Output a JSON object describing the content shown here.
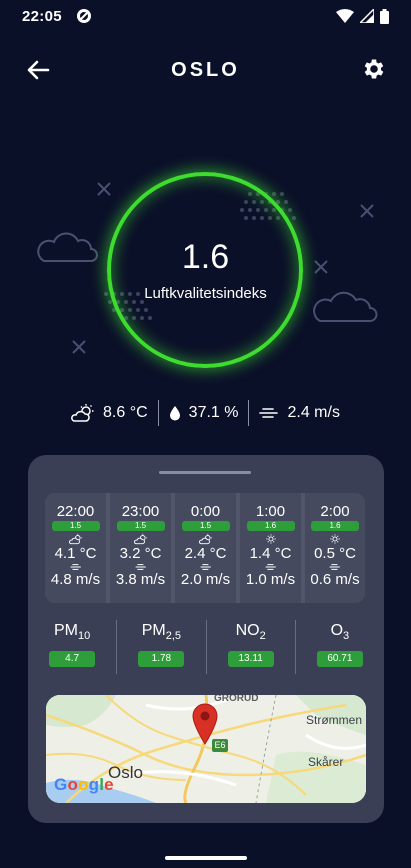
{
  "status_bar": {
    "time": "22:05"
  },
  "header": {
    "title": "OSLO"
  },
  "aqi": {
    "value": "1.6",
    "label": "Luftkvalitetsindeks"
  },
  "weather": {
    "temperature": "8.6 °C",
    "humidity": "37.1 %",
    "wind": "2.4 m/s"
  },
  "forecast": [
    {
      "time": "22:00",
      "aqi": "1.5",
      "icon": "partly-cloudy-icon",
      "temp": "4.1 °C",
      "wind": "4.8 m/s"
    },
    {
      "time": "23:00",
      "aqi": "1.5",
      "icon": "partly-cloudy-icon",
      "temp": "3.2 °C",
      "wind": "3.8 m/s"
    },
    {
      "time": "0:00",
      "aqi": "1.5",
      "icon": "partly-cloudy-icon",
      "temp": "2.4 °C",
      "wind": "2.0 m/s"
    },
    {
      "time": "1:00",
      "aqi": "1.6",
      "icon": "sun-icon",
      "temp": "1.4 °C",
      "wind": "1.0 m/s"
    },
    {
      "time": "2:00",
      "aqi": "1.6",
      "icon": "sun-icon",
      "temp": "0.5 °C",
      "wind": "0.6 m/s"
    }
  ],
  "pollutants": [
    {
      "name": "PM",
      "sub": "10",
      "value": "4.7"
    },
    {
      "name": "PM",
      "sub": "2,5",
      "value": "1.78"
    },
    {
      "name": "NO",
      "sub": "2",
      "value": "13.11"
    },
    {
      "name": "O",
      "sub": "3",
      "value": "60.71"
    }
  ],
  "map": {
    "labels": {
      "grorud": "GRORUD",
      "strommen": "Strømmen",
      "skarer": "Skårer",
      "oslo": "Oslo",
      "road": "E6"
    },
    "provider": "Google"
  },
  "colors": {
    "background": "#0b1029",
    "ring": "#3ddc2e",
    "badge": "#2e9e3a",
    "panel": "#3b3f55",
    "pin": "#d93025"
  }
}
